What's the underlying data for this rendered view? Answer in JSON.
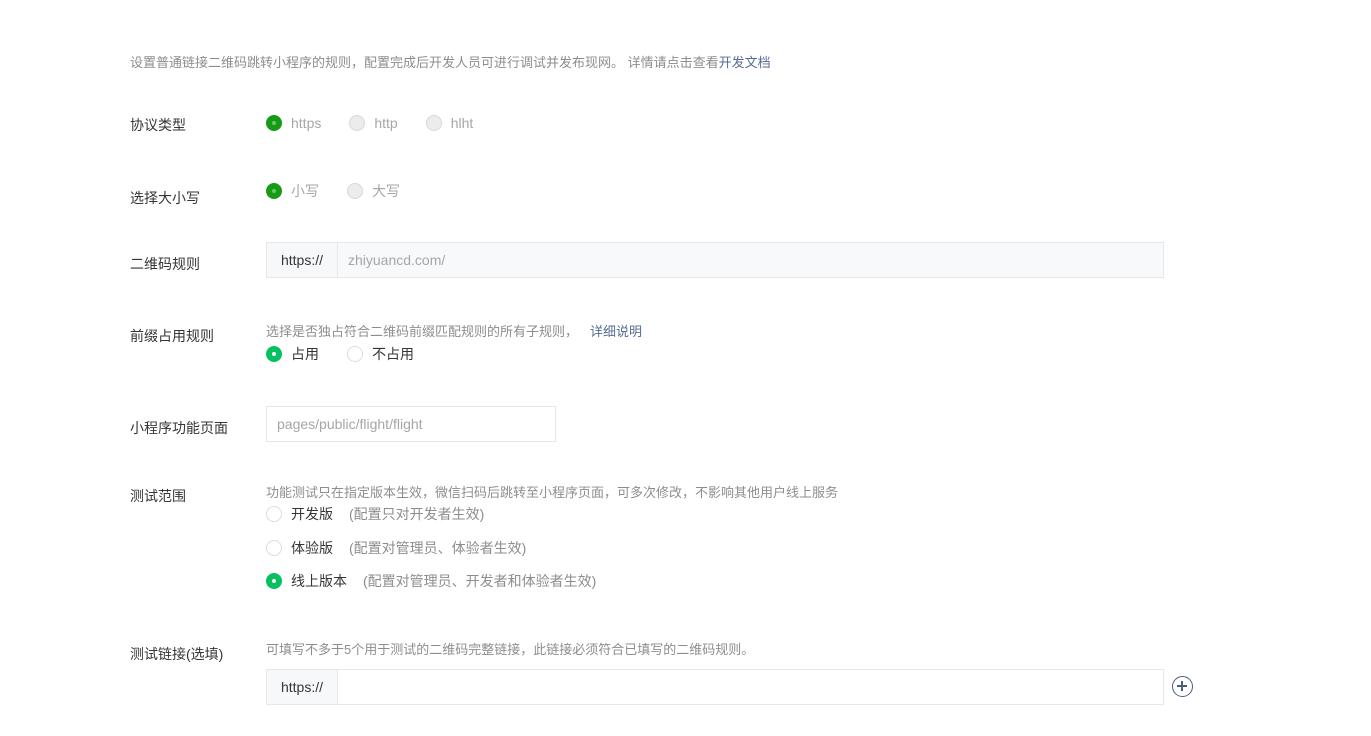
{
  "intro": {
    "text": "设置普通链接二维码跳转小程序的规则，配置完成后开发人员可进行调试并发布现网。 详情请点击查看",
    "doc_link": "开发文档"
  },
  "protocol": {
    "label": "协议类型",
    "options": [
      "https",
      "http",
      "hlht"
    ],
    "selected": "https"
  },
  "case": {
    "label": "选择大小写",
    "options": [
      "小写",
      "大写"
    ],
    "selected": "小写"
  },
  "qr_rule": {
    "label": "二维码规则",
    "prefix": "https://",
    "placeholder": "zhiyuancd.com/"
  },
  "prefix_rule": {
    "label": "前缀占用规则",
    "hint": "选择是否独占符合二维码前缀匹配规则的所有子规则，",
    "detail_link": "详细说明",
    "options": [
      "占用",
      "不占用"
    ],
    "selected": "占用"
  },
  "page": {
    "label": "小程序功能页面",
    "placeholder": "pages/public/flight/flight"
  },
  "test_scope": {
    "label": "测试范围",
    "hint": "功能测试只在指定版本生效，微信扫码后跳转至小程序页面，可多次修改，不影响其他用户线上服务",
    "options": [
      {
        "label": "开发版",
        "note": "(配置只对开发者生效)"
      },
      {
        "label": "体验版",
        "note": "(配置对管理员、体验者生效)"
      },
      {
        "label": "线上版本",
        "note": "(配置对管理员、开发者和体验者生效)"
      }
    ],
    "selected": "线上版本"
  },
  "test_link": {
    "label": "测试链接(选填)",
    "hint": "可填写不多于5个用于测试的二维码完整链接，此链接必须符合已填写的二维码规则。",
    "prefix": "https://",
    "value": ""
  },
  "colors": {
    "accent": "#07c160",
    "disabled_accent": "#179b16",
    "link": "#576b95"
  }
}
